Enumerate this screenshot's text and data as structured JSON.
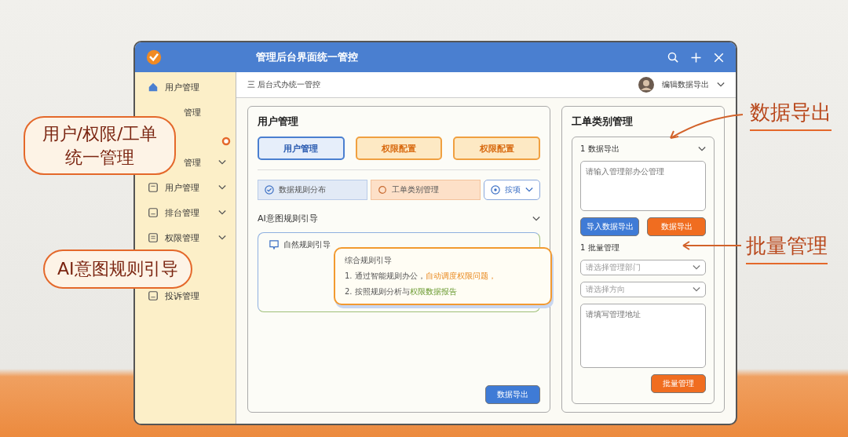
{
  "window": {
    "title": "管理后台界面统一管控"
  },
  "topbar": {
    "breadcrumb": "三 后台式办统一管控",
    "user": "编辑数据导出"
  },
  "sidebar": {
    "items": [
      {
        "label": "用户管理",
        "kind": "home",
        "chevron": false
      },
      {
        "label": "管理",
        "kind": "hidden",
        "chevron": false
      },
      {
        "label": "管理",
        "kind": "hidden",
        "chevron": true
      },
      {
        "label": "用户管理",
        "kind": "doc",
        "chevron": true
      },
      {
        "label": "排台管理",
        "kind": "box",
        "chevron": true
      },
      {
        "label": "权限管理",
        "kind": "list",
        "chevron": true
      },
      {
        "label": "投诉管理",
        "kind": "box",
        "chevron": false
      }
    ]
  },
  "main": {
    "title": "用户管理",
    "tabs": [
      {
        "label": "用户管理",
        "selected": true
      },
      {
        "label": "权限配置",
        "selected": false
      },
      {
        "label": "权限配置",
        "selected": false
      }
    ],
    "segments": [
      {
        "label": "数据规则分布",
        "kind": "check"
      },
      {
        "label": "工单类别管理",
        "kind": "circle"
      }
    ],
    "dropdown": "按项",
    "section": "AI意图规则引导",
    "rule_label": "自然规则引导",
    "tip": {
      "title": "综合规则引导",
      "lines": [
        [
          {
            "text": "1. 通过智能规则办公，",
            "kind": "plain"
          },
          {
            "text": "自动调度权限问题，",
            "kind": "orange"
          }
        ],
        [
          {
            "text": "2. 按照规则分析与",
            "kind": "plain"
          },
          {
            "text": "权限数据报告",
            "kind": "green"
          }
        ]
      ]
    },
    "button": "数据导出"
  },
  "right": {
    "title": "工单类别管理",
    "export": {
      "heading": "1 数据导出",
      "placeholder": "请输入管理部办公管理",
      "buttons": [
        {
          "label": "导入数据导出",
          "kind": "blue"
        },
        {
          "label": "数据导出",
          "kind": "orange"
        }
      ]
    },
    "batch": {
      "heading": "1 批量管理",
      "selects": [
        "请选择管理部门",
        "请选择方向"
      ],
      "placeholder": "请填写管理地址",
      "button": "批量管理"
    }
  },
  "callouts": [
    {
      "text": "用户/权限/工单统一管理"
    },
    {
      "text": "AI意图规则引导"
    }
  ],
  "notes": [
    {
      "text": "数据导出"
    },
    {
      "text": "批量管理"
    }
  ]
}
